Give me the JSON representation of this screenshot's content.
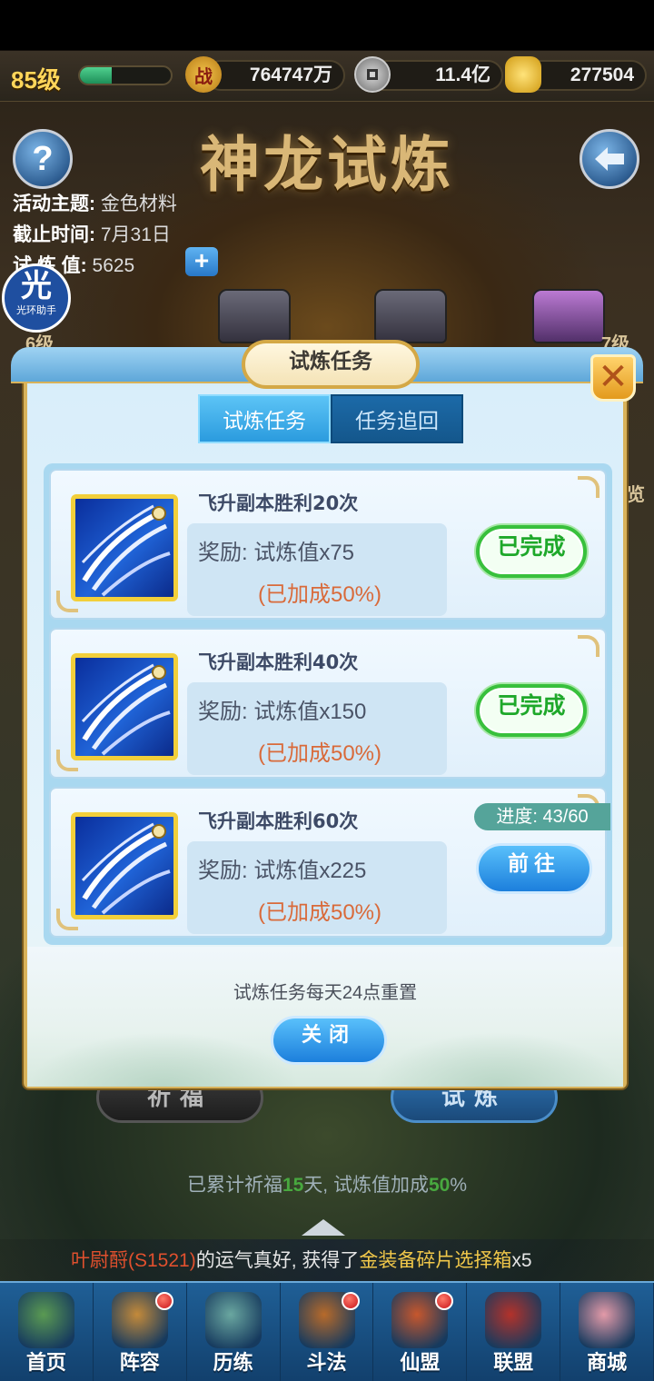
{
  "status": {
    "level": "85级",
    "xp_fraction": 0.35,
    "power": "764747万",
    "power_icon": "战",
    "coins": "11.4亿",
    "gold": "277504"
  },
  "page": {
    "title": "神龙试炼",
    "help_icon": "?",
    "info": [
      {
        "label": "活动主题:",
        "value": "金色材料"
      },
      {
        "label": "截止时间:",
        "value": "7月31日"
      },
      {
        "label": "试 炼 值:",
        "value": "5625"
      }
    ],
    "plus": "+",
    "helper": {
      "glyph": "光",
      "label": "光环助手"
    },
    "tier_left": "6级",
    "tier_right": "7级",
    "side_text": "览",
    "btn_pray": "祈福",
    "btn_trial": "试炼",
    "accum": {
      "pre": "已累计祈福",
      "days": "15",
      "mid": "天, 试炼值加成",
      "pct": "50",
      "post": "%"
    },
    "marquee": {
      "name": "叶尉酹(S1521)",
      "mid": "的运气真好, 获得了",
      "item": "金装备碎片选择箱",
      "qty": "x5"
    }
  },
  "nav": [
    {
      "label": "首页",
      "icon": "home-island-icon",
      "dot": false,
      "color": "#5a9a52"
    },
    {
      "label": "阵容",
      "icon": "lineup-icon",
      "dot": true,
      "color": "#c48a3a"
    },
    {
      "label": "历练",
      "icon": "training-icon",
      "dot": false,
      "color": "#6aa7a0"
    },
    {
      "label": "斗法",
      "icon": "battle-icon",
      "dot": true,
      "color": "#b76a2a"
    },
    {
      "label": "仙盟",
      "icon": "alliance-palace-icon",
      "dot": true,
      "color": "#c7572d"
    },
    {
      "label": "联盟",
      "icon": "league-icon",
      "dot": false,
      "color": "#b3322a"
    },
    {
      "label": "商城",
      "icon": "shop-cat-icon",
      "dot": false,
      "color": "#e39aa8"
    }
  ],
  "dialog": {
    "title": "试炼任务",
    "close_glyph": "✕",
    "tabs": [
      {
        "label": "试炼任务",
        "active": true
      },
      {
        "label": "任务追回",
        "active": false
      }
    ],
    "tasks": [
      {
        "name": "飞升副本胜利20次",
        "reward": "奖励: 试炼值x75",
        "bonus": "(已加成50%)",
        "status": "已完成"
      },
      {
        "name": "飞升副本胜利40次",
        "reward": "奖励: 试炼值x150",
        "bonus": "(已加成50%)",
        "status": "已完成"
      },
      {
        "name": "飞升副本胜利60次",
        "reward": "奖励: 试炼值x225",
        "bonus": "(已加成50%)",
        "progress": "进度: 43/60",
        "action": "前往"
      }
    ],
    "reset_note": "试炼任务每天24点重置",
    "close_label": "关闭"
  }
}
